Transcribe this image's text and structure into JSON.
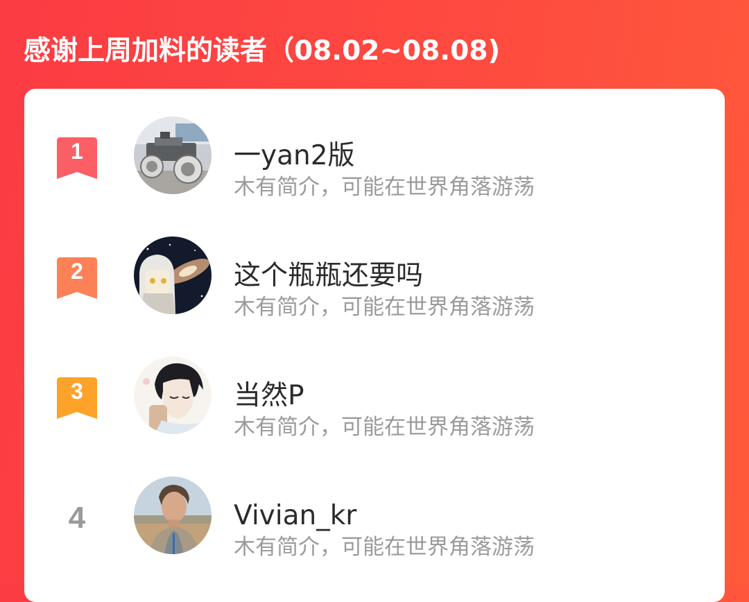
{
  "header": {
    "title": "感谢上周加料的读者（08.02~08.08)"
  },
  "colors": {
    "background": "#fb3c43",
    "rank_1": "#fb5e65",
    "rank_2": "#fd8157",
    "rank_3": "#fda32a",
    "rank_4": "#9a9a9a"
  },
  "readers": [
    {
      "rank": "1",
      "name": "一yan2版",
      "bio": "木有简介，可能在世界角落游荡",
      "avatar": "robot-car-avatar"
    },
    {
      "rank": "2",
      "name": "这个瓶瓶还要吗",
      "bio": "木有简介，可能在世界角落游荡",
      "avatar": "anime-galaxy-avatar"
    },
    {
      "rank": "3",
      "name": "当然P",
      "bio": "木有简介，可能在世界角落游荡",
      "avatar": "manga-boy-avatar"
    },
    {
      "rank": "4",
      "name": "Vivian_kr",
      "bio": "木有简介，可能在世界角落游荡",
      "avatar": "man-portrait-avatar"
    }
  ]
}
